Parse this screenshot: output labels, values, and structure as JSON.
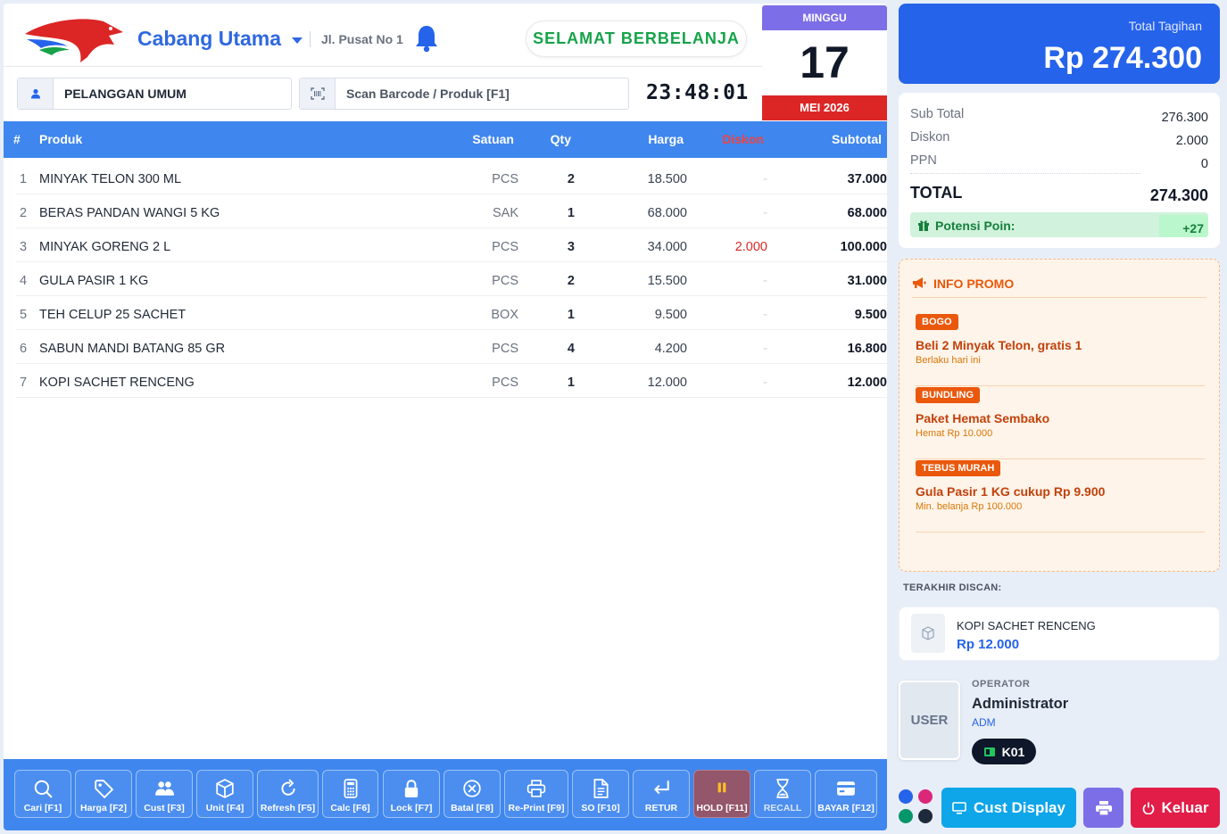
{
  "header": {
    "branch": "Cabang Utama",
    "address": "Jl. Pusat No 1",
    "welcome": "SELAMAT BERBELANJA",
    "calendar": {
      "weekday": "MINGGU",
      "day": "17",
      "month_year": "MEI 2026"
    },
    "customer": "PELANGGAN UMUM",
    "scan_placeholder": "Scan Barcode / Produk [F1]",
    "clock": "23:48:01"
  },
  "table": {
    "headers": {
      "no": "#",
      "product": "Produk",
      "unit": "Satuan",
      "qty": "Qty",
      "price": "Harga",
      "discount": "Diskon",
      "subtotal": "Subtotal"
    },
    "rows": [
      {
        "no": "1",
        "product": "MINYAK TELON 300 ML",
        "unit": "PCS",
        "qty": "2",
        "price": "18.500",
        "discount": "-",
        "subtotal": "37.000"
      },
      {
        "no": "2",
        "product": "BERAS PANDAN WANGI 5 KG",
        "unit": "SAK",
        "qty": "1",
        "price": "68.000",
        "discount": "-",
        "subtotal": "68.000"
      },
      {
        "no": "3",
        "product": "MINYAK GORENG 2 L",
        "unit": "PCS",
        "qty": "3",
        "price": "34.000",
        "discount": "2.000",
        "subtotal": "100.000"
      },
      {
        "no": "4",
        "product": "GULA PASIR 1 KG",
        "unit": "PCS",
        "qty": "2",
        "price": "15.500",
        "discount": "-",
        "subtotal": "31.000"
      },
      {
        "no": "5",
        "product": "TEH CELUP 25 SACHET",
        "unit": "BOX",
        "qty": "1",
        "price": "9.500",
        "discount": "-",
        "subtotal": "9.500"
      },
      {
        "no": "6",
        "product": "SABUN MANDI BATANG 85 GR",
        "unit": "PCS",
        "qty": "4",
        "price": "4.200",
        "discount": "-",
        "subtotal": "16.800"
      },
      {
        "no": "7",
        "product": "KOPI SACHET RENCENG",
        "unit": "PCS",
        "qty": "1",
        "price": "12.000",
        "discount": "-",
        "subtotal": "12.000"
      }
    ]
  },
  "toolbar": [
    {
      "label": "Cari [F1]",
      "icon": "search-icon"
    },
    {
      "label": "Harga [F2]",
      "icon": "tag-icon"
    },
    {
      "label": "Cust [F3]",
      "icon": "users-icon"
    },
    {
      "label": "Unit [F4]",
      "icon": "box-icon"
    },
    {
      "label": "Refresh [F5]",
      "icon": "refresh-icon"
    },
    {
      "label": "Calc [F6]",
      "icon": "calculator-icon"
    },
    {
      "label": "Lock [F7]",
      "icon": "lock-icon"
    },
    {
      "label": "Batal [F8]",
      "icon": "cancel-icon"
    },
    {
      "label": "Re-Print [F9]",
      "icon": "printer-icon"
    },
    {
      "label": "SO [F10]",
      "icon": "document-icon"
    },
    {
      "label": "RETUR",
      "icon": "return-icon"
    },
    {
      "label": "HOLD [F11]",
      "icon": "pause-icon"
    },
    {
      "label": "RECALL",
      "icon": "hourglass-icon"
    },
    {
      "label": "BAYAR [F12]",
      "icon": "card-icon"
    }
  ],
  "summary": {
    "total_label": "Total Tagihan",
    "total_value": "Rp 274.300",
    "subtotal_label": "Sub Total",
    "subtotal_value": "276.300",
    "discount_label": "Diskon",
    "discount_value": "2.000",
    "tax_label": "PPN",
    "tax_value": "0",
    "grand_label": "TOTAL",
    "grand_value": "274.300",
    "points_label": "Potensi Poin:",
    "points_value": "+27"
  },
  "promo": {
    "title": "INFO PROMO",
    "items": [
      {
        "badge": "BOGO",
        "title": "Beli 2 Minyak Telon, gratis 1",
        "sub": "Berlaku hari ini"
      },
      {
        "badge": "BUNDLING",
        "title": "Paket Hemat Sembako",
        "sub": "Hemat Rp 10.000"
      },
      {
        "badge": "TEBUS MURAH",
        "title": "Gula Pasir 1 KG cukup Rp 9.900",
        "sub": "Min. belanja Rp 100.000"
      }
    ]
  },
  "last_scan": {
    "label": "TERAKHIR DISCAN:",
    "name": "KOPI SACHET RENCENG",
    "price": "Rp 12.000"
  },
  "operator": {
    "avatar": "USER",
    "label": "OPERATOR",
    "name": "Administrator",
    "role": "ADM",
    "register": "K01"
  },
  "actions": {
    "cust_display": "Cust Display",
    "logout": "Keluar"
  },
  "colors": {
    "primary": "#3f86ee",
    "accent": "#2563eb",
    "danger": "#e11d48",
    "success": "#16a34a",
    "promo": "#ea580c"
  },
  "theme_dots": [
    "#2563eb",
    "#db2777",
    "#059669",
    "#1e293b"
  ]
}
